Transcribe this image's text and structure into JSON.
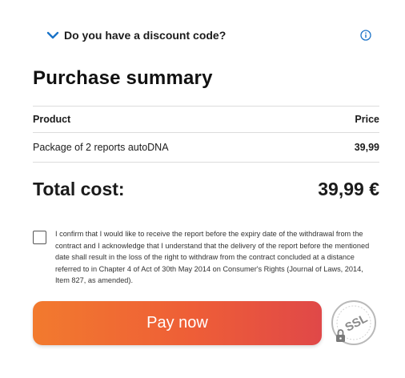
{
  "discount": {
    "label": "Do you have a discount code?"
  },
  "summary": {
    "title": "Purchase summary",
    "columns": {
      "product": "Product",
      "price": "Price"
    },
    "items": [
      {
        "name": "Package of 2 reports autoDNA",
        "price": "39,99"
      }
    ],
    "total_label": "Total cost:",
    "total_value": "39,99 €"
  },
  "consent": {
    "checked": false,
    "text": "I confirm that I would like to receive the report before the expiry date of the withdrawal from the contract and I acknowledge that I understand that the delivery of the report before the mentioned date shall result in the loss of the right to withdraw from the contract concluded at a distance referred to in Chapter 4 of Act of 30th May 2014 on Consumer's Rights (Journal of Laws, 2014, Item 827, as amended)."
  },
  "pay": {
    "label": "Pay now"
  },
  "ssl_badge": {
    "label": "SSL",
    "icon": "lock-icon"
  },
  "colors": {
    "accent": "#1a73c8",
    "pay_start": "#f27a2e",
    "pay_end": "#e04848"
  }
}
